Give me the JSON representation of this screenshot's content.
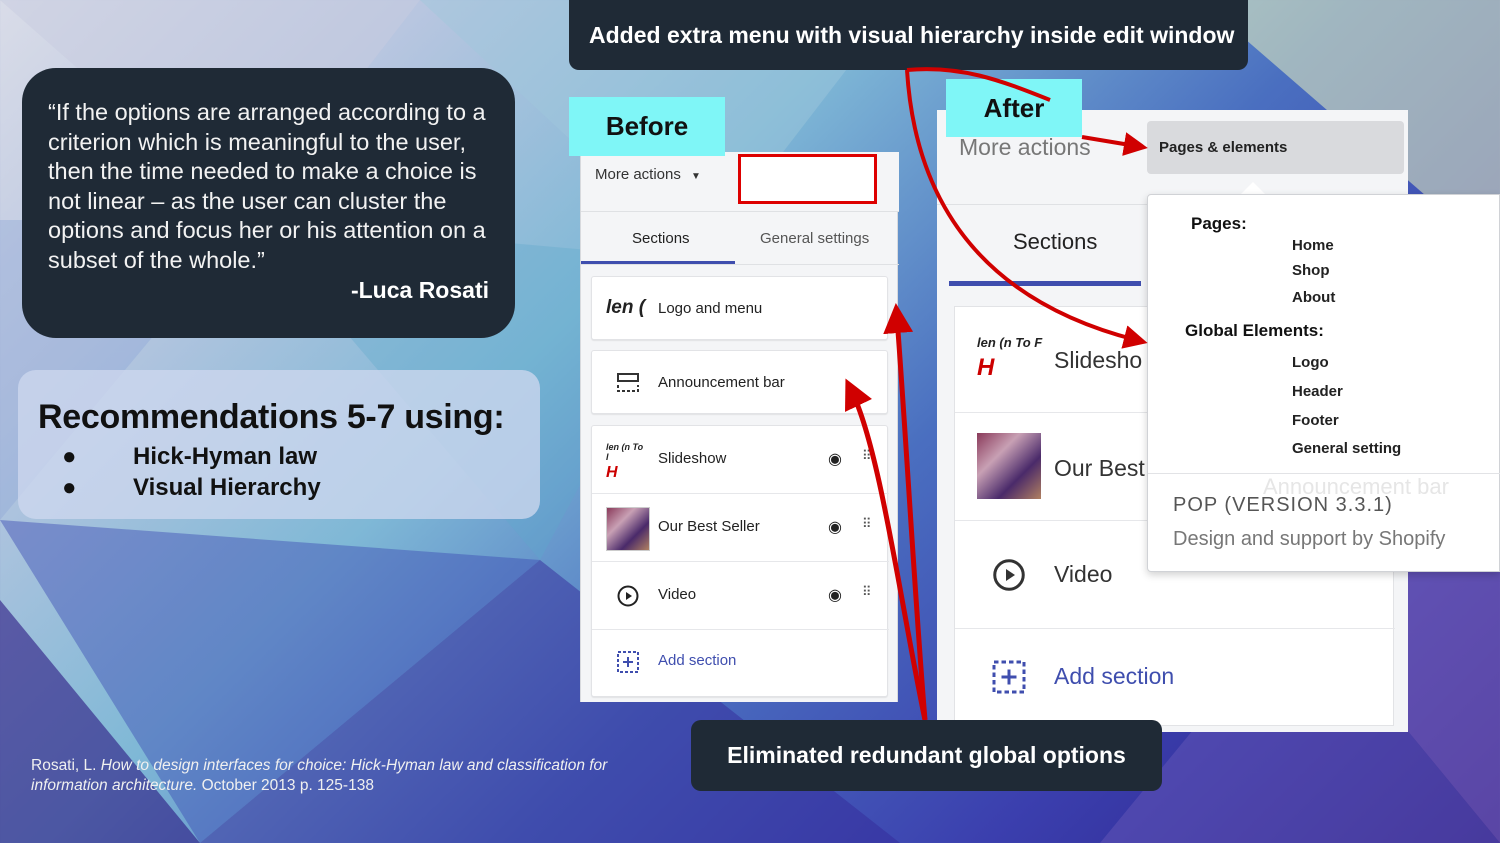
{
  "quote": {
    "text": "“If the options are arranged according to a criterion which is meaningful to the user, then the time needed to make a choice is not linear – as the user can cluster the options and focus her or his attention on a subset of the whole.”",
    "author": "-Luca Rosati"
  },
  "recommendations": {
    "title": "Recommendations 5-7 using:",
    "items": [
      "Hick-Hyman law",
      "Visual Hierarchy"
    ],
    "bullet": "●"
  },
  "citation": {
    "prefix": "Rosati, L.",
    "title": "How to design interfaces for choice: Hick-Hyman law and classification for information architecture.",
    "suffix": "October 2013 p. 125-138"
  },
  "banners": {
    "top": "Added extra menu with visual hierarchy inside edit window",
    "bottom": "Eliminated redundant global options"
  },
  "labels": {
    "before": "Before",
    "after": "After"
  },
  "before": {
    "more_actions": "More actions",
    "tabs": [
      "Sections",
      "General settings"
    ],
    "card1": [
      "Logo and menu",
      "Announcement bar"
    ],
    "card2": [
      "Slideshow",
      "Our Best Seller",
      "Video",
      "Add section"
    ],
    "logo_text": "len (",
    "slide_text": "len (n To I"
  },
  "after": {
    "more_actions": "More actions",
    "tab": "Sections",
    "rows": [
      "Slidesho",
      "Our Best",
      "Video",
      "Add section"
    ],
    "slide_text": "len (n To F",
    "pages_button": "Pages & elements",
    "dropdown": {
      "pages_heading": "Pages:",
      "pages": [
        "Home",
        "Shop",
        "About"
      ],
      "global_heading": "Global Elements:",
      "globals": [
        "Logo",
        "Header",
        "Footer",
        "General setting"
      ],
      "version": "POP (VERSION 3.3.1)",
      "design": "Design and support by Shopify",
      "ghost": "Announcement bar"
    }
  },
  "colors": {
    "accent": "#3f4eae",
    "highlight": "#7ff6f7",
    "arrow": "#d00000",
    "dark_box": "#1f2a36"
  }
}
